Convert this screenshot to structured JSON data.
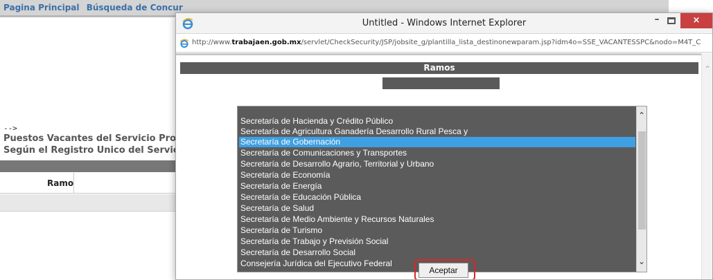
{
  "background_page": {
    "nav_items": [
      "Pagina Principal",
      "Búsqueda de Concur"
    ],
    "arrow_text": "-->",
    "heading_line1": "Puestos Vacantes del Servicio Profe",
    "heading_line2": "Según el Registro Unico del Servicio",
    "table_header": "Ramo"
  },
  "popup": {
    "title": "Untitled - Windows Internet Explorer",
    "address_prefix": "http://www.",
    "address_domain": "trabajaen.gob.mx",
    "address_rest": "/servlet/CheckSecurity/JSP/jobsite_g/plantilla_lista_destinonewparam.jsp?idm4o=SSE_VACANTESSPC&nodo=M4T_C",
    "heading": "Ramos",
    "list_items": [
      "Secretaría de Hacienda y Crédito Público",
      "Secretaría de Agricultura Ganadería Desarrollo Rural Pesca y",
      "Secretaría de Gobernación",
      "Secretaría de Comunicaciones y Transportes",
      "Secretaría de Desarrollo Agrario, Territorial y Urbano",
      "Secretaría de Economía",
      "Secretaría de Energía",
      "Secretaría de Educación Pública",
      "Secretaría de Salud",
      "Secretaría de Medio Ambiente y Recursos Naturales",
      "Secretaría de Turismo",
      "Secretaría de Trabajo y Previsión Social",
      "Secretaría de Desarrollo Social",
      "Consejería Jurídica del Ejecutivo Federal"
    ],
    "selected_item": "Secretaría de Gobernación",
    "accept_label": "Aceptar",
    "close_glyph": "×",
    "minimize_glyph": "–"
  },
  "colors": {
    "nav_text": "#3c6fa8",
    "listbox_bg": "#5b5b5b",
    "selection": "#3e9fe2",
    "close_button": "#c84040",
    "highlight": "#e02424"
  }
}
